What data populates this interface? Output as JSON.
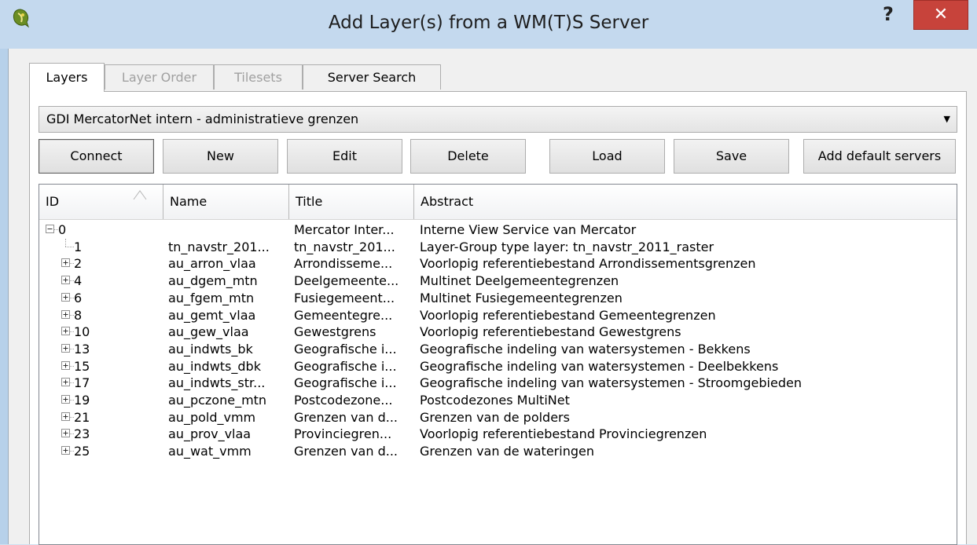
{
  "window": {
    "title": "Add Layer(s) from a WM(T)S Server",
    "help_label": "?",
    "close_label": "✕"
  },
  "tabs": [
    {
      "label": "Layers",
      "state": "active"
    },
    {
      "label": "Layer Order",
      "state": "disabled"
    },
    {
      "label": "Tilesets",
      "state": "disabled"
    },
    {
      "label": "Server Search",
      "state": "normal"
    }
  ],
  "server_select": {
    "value": "GDI MercatorNet intern - administratieve grenzen"
  },
  "buttons": {
    "connect": "Connect",
    "new": "New",
    "edit": "Edit",
    "delete": "Delete",
    "load": "Load",
    "save": "Save",
    "add_default": "Add default servers"
  },
  "table": {
    "columns": [
      "ID",
      "Name",
      "Title",
      "Abstract"
    ],
    "rows": [
      {
        "id": "0",
        "name": "",
        "title": "Mercator Inter...",
        "abstract": "Interne View Service van Mercator",
        "level": 0,
        "expander": "minus"
      },
      {
        "id": "1",
        "name": "tn_navstr_201...",
        "title": "tn_navstr_201...",
        "abstract": "Layer-Group type layer: tn_navstr_2011_raster",
        "level": 1,
        "expander": "none"
      },
      {
        "id": "2",
        "name": "au_arron_vlaa",
        "title": "Arrondisseme...",
        "abstract": "Voorlopig referentiebestand Arrondissementsgrenzen",
        "level": 1,
        "expander": "plus"
      },
      {
        "id": "4",
        "name": "au_dgem_mtn",
        "title": "Deelgemeente...",
        "abstract": "Multinet Deelgemeentegrenzen",
        "level": 1,
        "expander": "plus"
      },
      {
        "id": "6",
        "name": "au_fgem_mtn",
        "title": "Fusiegemeent...",
        "abstract": "Multinet Fusiegemeentegrenzen",
        "level": 1,
        "expander": "plus"
      },
      {
        "id": "8",
        "name": "au_gemt_vlaa",
        "title": "Gemeentegre...",
        "abstract": "Voorlopig referentiebestand Gemeentegrenzen",
        "level": 1,
        "expander": "plus"
      },
      {
        "id": "10",
        "name": "au_gew_vlaa",
        "title": "Gewestgrens",
        "abstract": "Voorlopig referentiebestand Gewestgrens",
        "level": 1,
        "expander": "plus"
      },
      {
        "id": "13",
        "name": "au_indwts_bk",
        "title": "Geografische i...",
        "abstract": "Geografische indeling van watersystemen - Bekkens",
        "level": 1,
        "expander": "plus"
      },
      {
        "id": "15",
        "name": "au_indwts_dbk",
        "title": "Geografische i...",
        "abstract": "Geografische indeling van watersystemen - Deelbekkens",
        "level": 1,
        "expander": "plus"
      },
      {
        "id": "17",
        "name": "au_indwts_str...",
        "title": "Geografische i...",
        "abstract": "Geografische indeling van watersystemen - Stroomgebieden",
        "level": 1,
        "expander": "plus"
      },
      {
        "id": "19",
        "name": "au_pczone_mtn",
        "title": "Postcodezone...",
        "abstract": "Postcodezones MultiNet",
        "level": 1,
        "expander": "plus"
      },
      {
        "id": "21",
        "name": "au_pold_vmm",
        "title": "Grenzen van d...",
        "abstract": "Grenzen van de polders",
        "level": 1,
        "expander": "plus"
      },
      {
        "id": "23",
        "name": "au_prov_vlaa",
        "title": "Provinciegren...",
        "abstract": "Voorlopig referentiebestand Provinciegrenzen",
        "level": 1,
        "expander": "plus"
      },
      {
        "id": "25",
        "name": "au_wat_vmm",
        "title": "Grenzen van d...",
        "abstract": "Grenzen van de wateringen",
        "level": 1,
        "expander": "plus"
      }
    ]
  },
  "icons": {
    "app": "qgis-logo-icon",
    "sort": "sort-ascending-icon",
    "dropdown": "chevron-down-icon"
  }
}
